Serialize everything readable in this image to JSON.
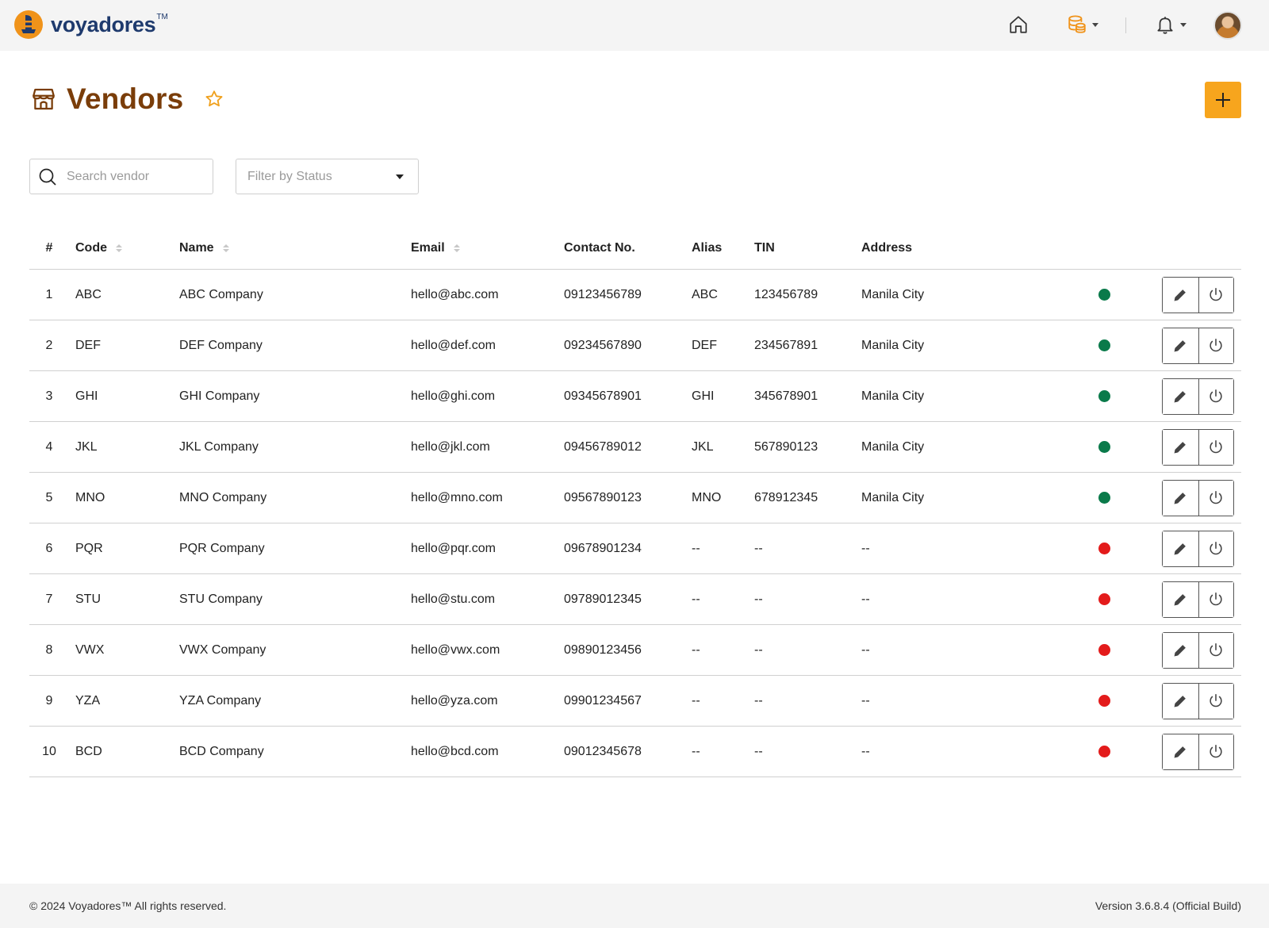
{
  "brand": {
    "name": "voyadores",
    "tm": "TM"
  },
  "colors": {
    "brand": "#f0931a",
    "title": "#7a3d09",
    "accent": "#f7a51d",
    "active": "#0a7a4a",
    "inactive": "#e31b1b"
  },
  "page": {
    "title": "Vendors"
  },
  "filters": {
    "search_placeholder": "Search vendor",
    "status_placeholder": "Filter by Status"
  },
  "table": {
    "headers": {
      "num": "#",
      "code": "Code",
      "name": "Name",
      "email": "Email",
      "contact": "Contact No.",
      "alias": "Alias",
      "tin": "TIN",
      "address": "Address"
    },
    "rows": [
      {
        "num": "1",
        "code": "ABC",
        "name": "ABC Company",
        "email": "hello@abc.com",
        "contact": "09123456789",
        "alias": "ABC",
        "tin": "123456789",
        "address": "Manila City",
        "status": "active"
      },
      {
        "num": "2",
        "code": "DEF",
        "name": "DEF Company",
        "email": "hello@def.com",
        "contact": "09234567890",
        "alias": "DEF",
        "tin": "234567891",
        "address": "Manila City",
        "status": "active"
      },
      {
        "num": "3",
        "code": "GHI",
        "name": "GHI Company",
        "email": "hello@ghi.com",
        "contact": "09345678901",
        "alias": "GHI",
        "tin": "345678901",
        "address": "Manila City",
        "status": "active"
      },
      {
        "num": "4",
        "code": "JKL",
        "name": "JKL Company",
        "email": "hello@jkl.com",
        "contact": "09456789012",
        "alias": "JKL",
        "tin": "567890123",
        "address": "Manila City",
        "status": "active"
      },
      {
        "num": "5",
        "code": "MNO",
        "name": "MNO Company",
        "email": "hello@mno.com",
        "contact": "09567890123",
        "alias": "MNO",
        "tin": "678912345",
        "address": "Manila City",
        "status": "active"
      },
      {
        "num": "6",
        "code": "PQR",
        "name": "PQR Company",
        "email": "hello@pqr.com",
        "contact": "09678901234",
        "alias": "--",
        "tin": "--",
        "address": "--",
        "status": "inactive"
      },
      {
        "num": "7",
        "code": "STU",
        "name": "STU Company",
        "email": "hello@stu.com",
        "contact": "09789012345",
        "alias": "--",
        "tin": "--",
        "address": "--",
        "status": "inactive"
      },
      {
        "num": "8",
        "code": "VWX",
        "name": "VWX Company",
        "email": "hello@vwx.com",
        "contact": "09890123456",
        "alias": "--",
        "tin": "--",
        "address": "--",
        "status": "inactive"
      },
      {
        "num": "9",
        "code": "YZA",
        "name": "YZA Company",
        "email": "hello@yza.com",
        "contact": "09901234567",
        "alias": "--",
        "tin": "--",
        "address": "--",
        "status": "inactive"
      },
      {
        "num": "10",
        "code": "BCD",
        "name": "BCD Company",
        "email": "hello@bcd.com",
        "contact": "09012345678",
        "alias": "--",
        "tin": "--",
        "address": "--",
        "status": "inactive"
      }
    ]
  },
  "footer": {
    "copyright": "© 2024 Voyadores™ All rights reserved.",
    "version": "Version 3.6.8.4 (Official Build)"
  }
}
